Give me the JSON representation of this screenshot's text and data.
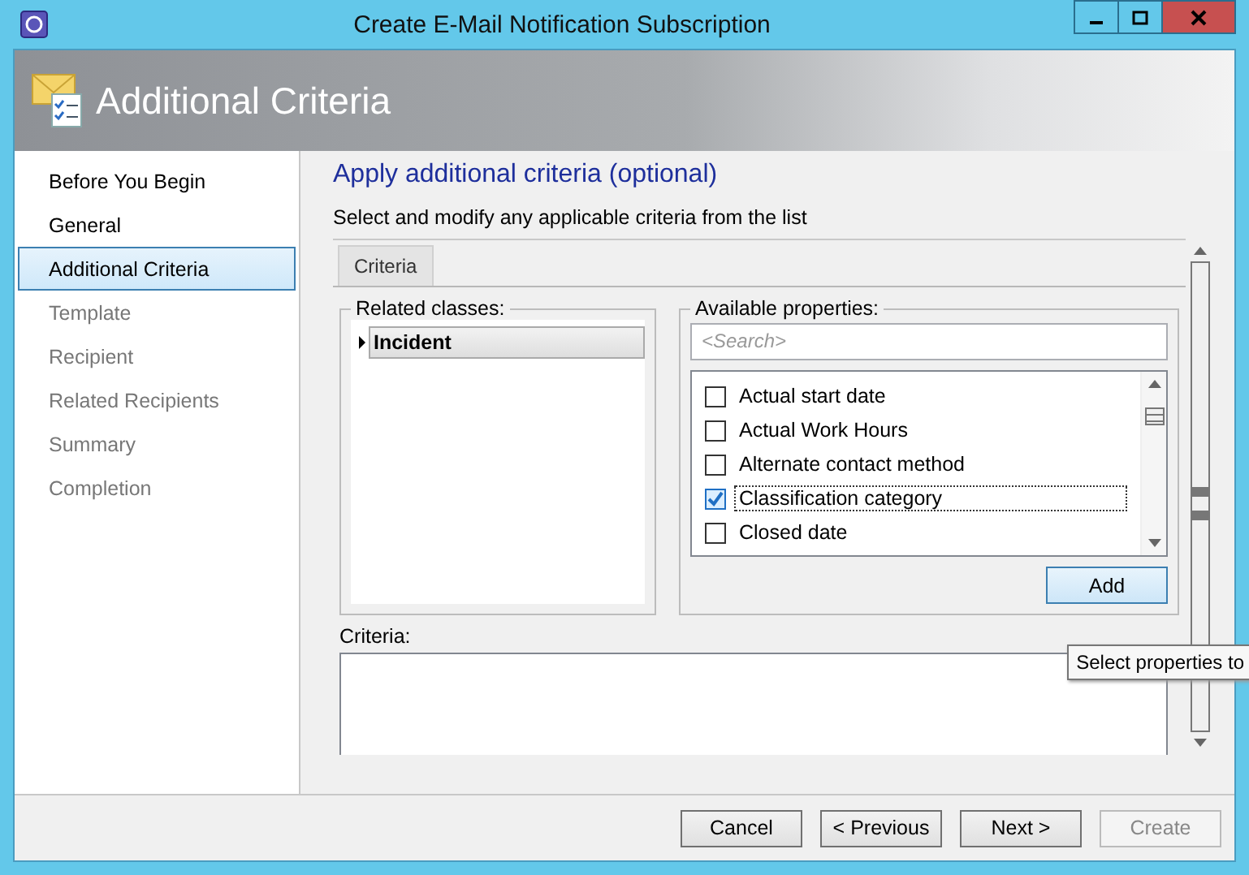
{
  "window": {
    "title": "Create E-Mail Notification Subscription"
  },
  "header": {
    "title": "Additional Criteria"
  },
  "steps": [
    {
      "label": "Before You Begin",
      "selected": false,
      "disabled": false
    },
    {
      "label": "General",
      "selected": false,
      "disabled": false
    },
    {
      "label": "Additional Criteria",
      "selected": true,
      "disabled": false
    },
    {
      "label": "Template",
      "selected": false,
      "disabled": true
    },
    {
      "label": "Recipient",
      "selected": false,
      "disabled": true
    },
    {
      "label": "Related Recipients",
      "selected": false,
      "disabled": true
    },
    {
      "label": "Summary",
      "selected": false,
      "disabled": true
    },
    {
      "label": "Completion",
      "selected": false,
      "disabled": true
    }
  ],
  "page": {
    "heading": "Apply additional criteria (optional)",
    "instruction": "Select and modify any applicable criteria from the list"
  },
  "tabs": [
    {
      "label": "Criteria",
      "selected": true
    }
  ],
  "related_classes": {
    "label": "Related classes:",
    "items": [
      {
        "label": "Incident",
        "expanded": false,
        "selected": true
      }
    ]
  },
  "available_properties": {
    "label": "Available properties:",
    "search": {
      "placeholder": "<Search>"
    },
    "items": [
      {
        "label": "Actual start date",
        "checked": false,
        "focused": false
      },
      {
        "label": "Actual Work Hours",
        "checked": false,
        "focused": false
      },
      {
        "label": "Alternate contact method",
        "checked": false,
        "focused": false
      },
      {
        "label": "Classification category",
        "checked": true,
        "focused": true
      },
      {
        "label": "Closed date",
        "checked": false,
        "focused": false
      }
    ],
    "add_button": {
      "label": "Add",
      "disabled": false
    }
  },
  "criteria": {
    "label": "Criteria:"
  },
  "tooltip": "Select properties to",
  "buttons": [
    {
      "label": "Cancel",
      "disabled": false
    },
    {
      "label": "< Previous",
      "disabled": false
    },
    {
      "label": "Next >",
      "disabled": false
    },
    {
      "label": "Create",
      "disabled": true
    }
  ]
}
